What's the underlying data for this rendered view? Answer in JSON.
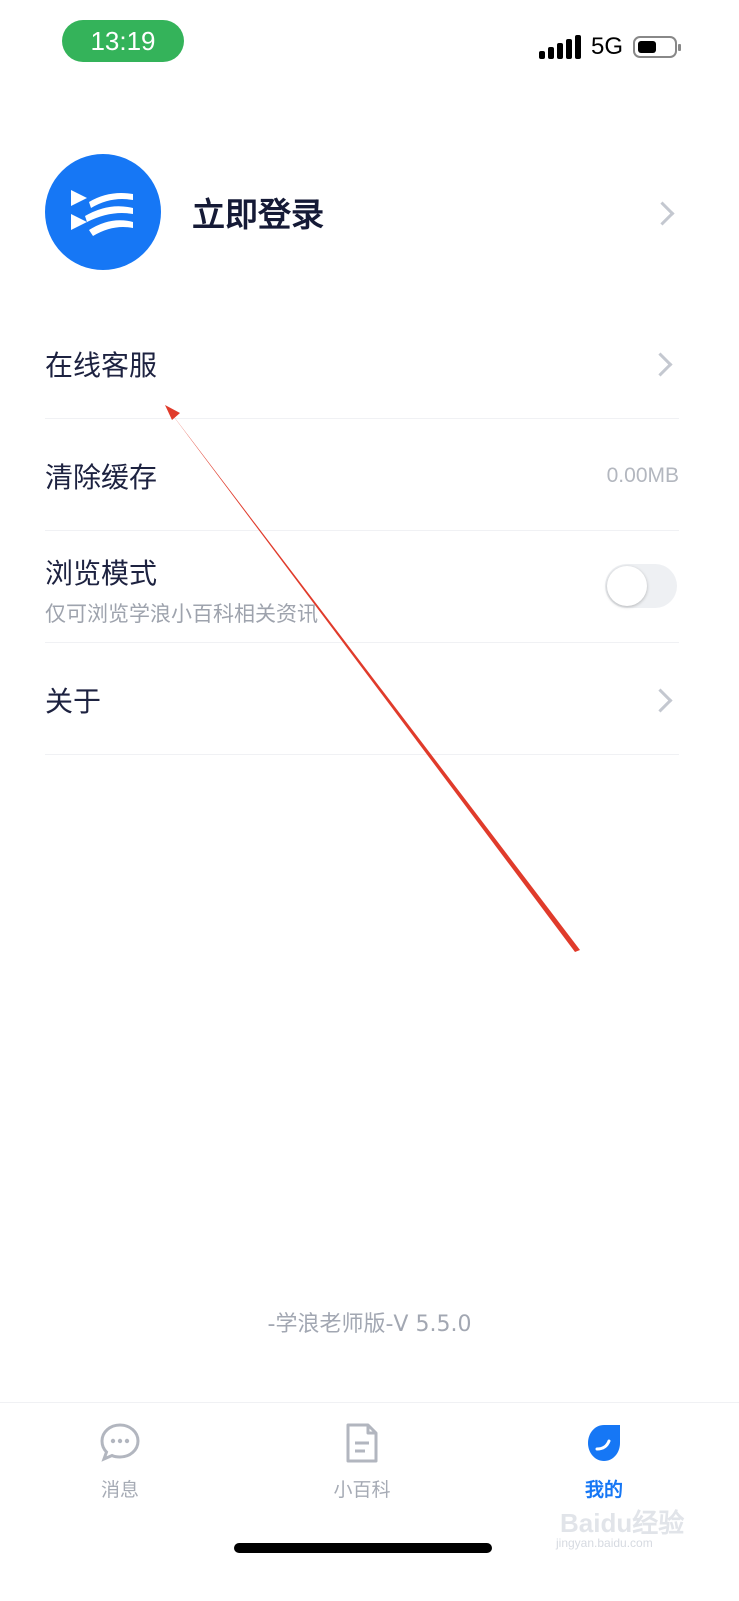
{
  "status_bar": {
    "time": "13:19",
    "network": "5G"
  },
  "profile": {
    "login_label": "立即登录"
  },
  "menu": {
    "online_service": "在线客服",
    "clear_cache": {
      "label": "清除缓存",
      "value": "0.00MB"
    },
    "browse_mode": {
      "label": "浏览模式",
      "desc": "仅可浏览学浪小百科相关资讯",
      "enabled": false
    },
    "about": "关于"
  },
  "version": "-学浪老师版-V 5.5.0",
  "tabbar": {
    "messages": "消息",
    "wiki": "小百科",
    "mine": "我的",
    "active": "mine"
  },
  "accent_color": "#1677f5",
  "watermark": {
    "text": "Baidu经验",
    "url": "jingyan.baidu.com"
  }
}
